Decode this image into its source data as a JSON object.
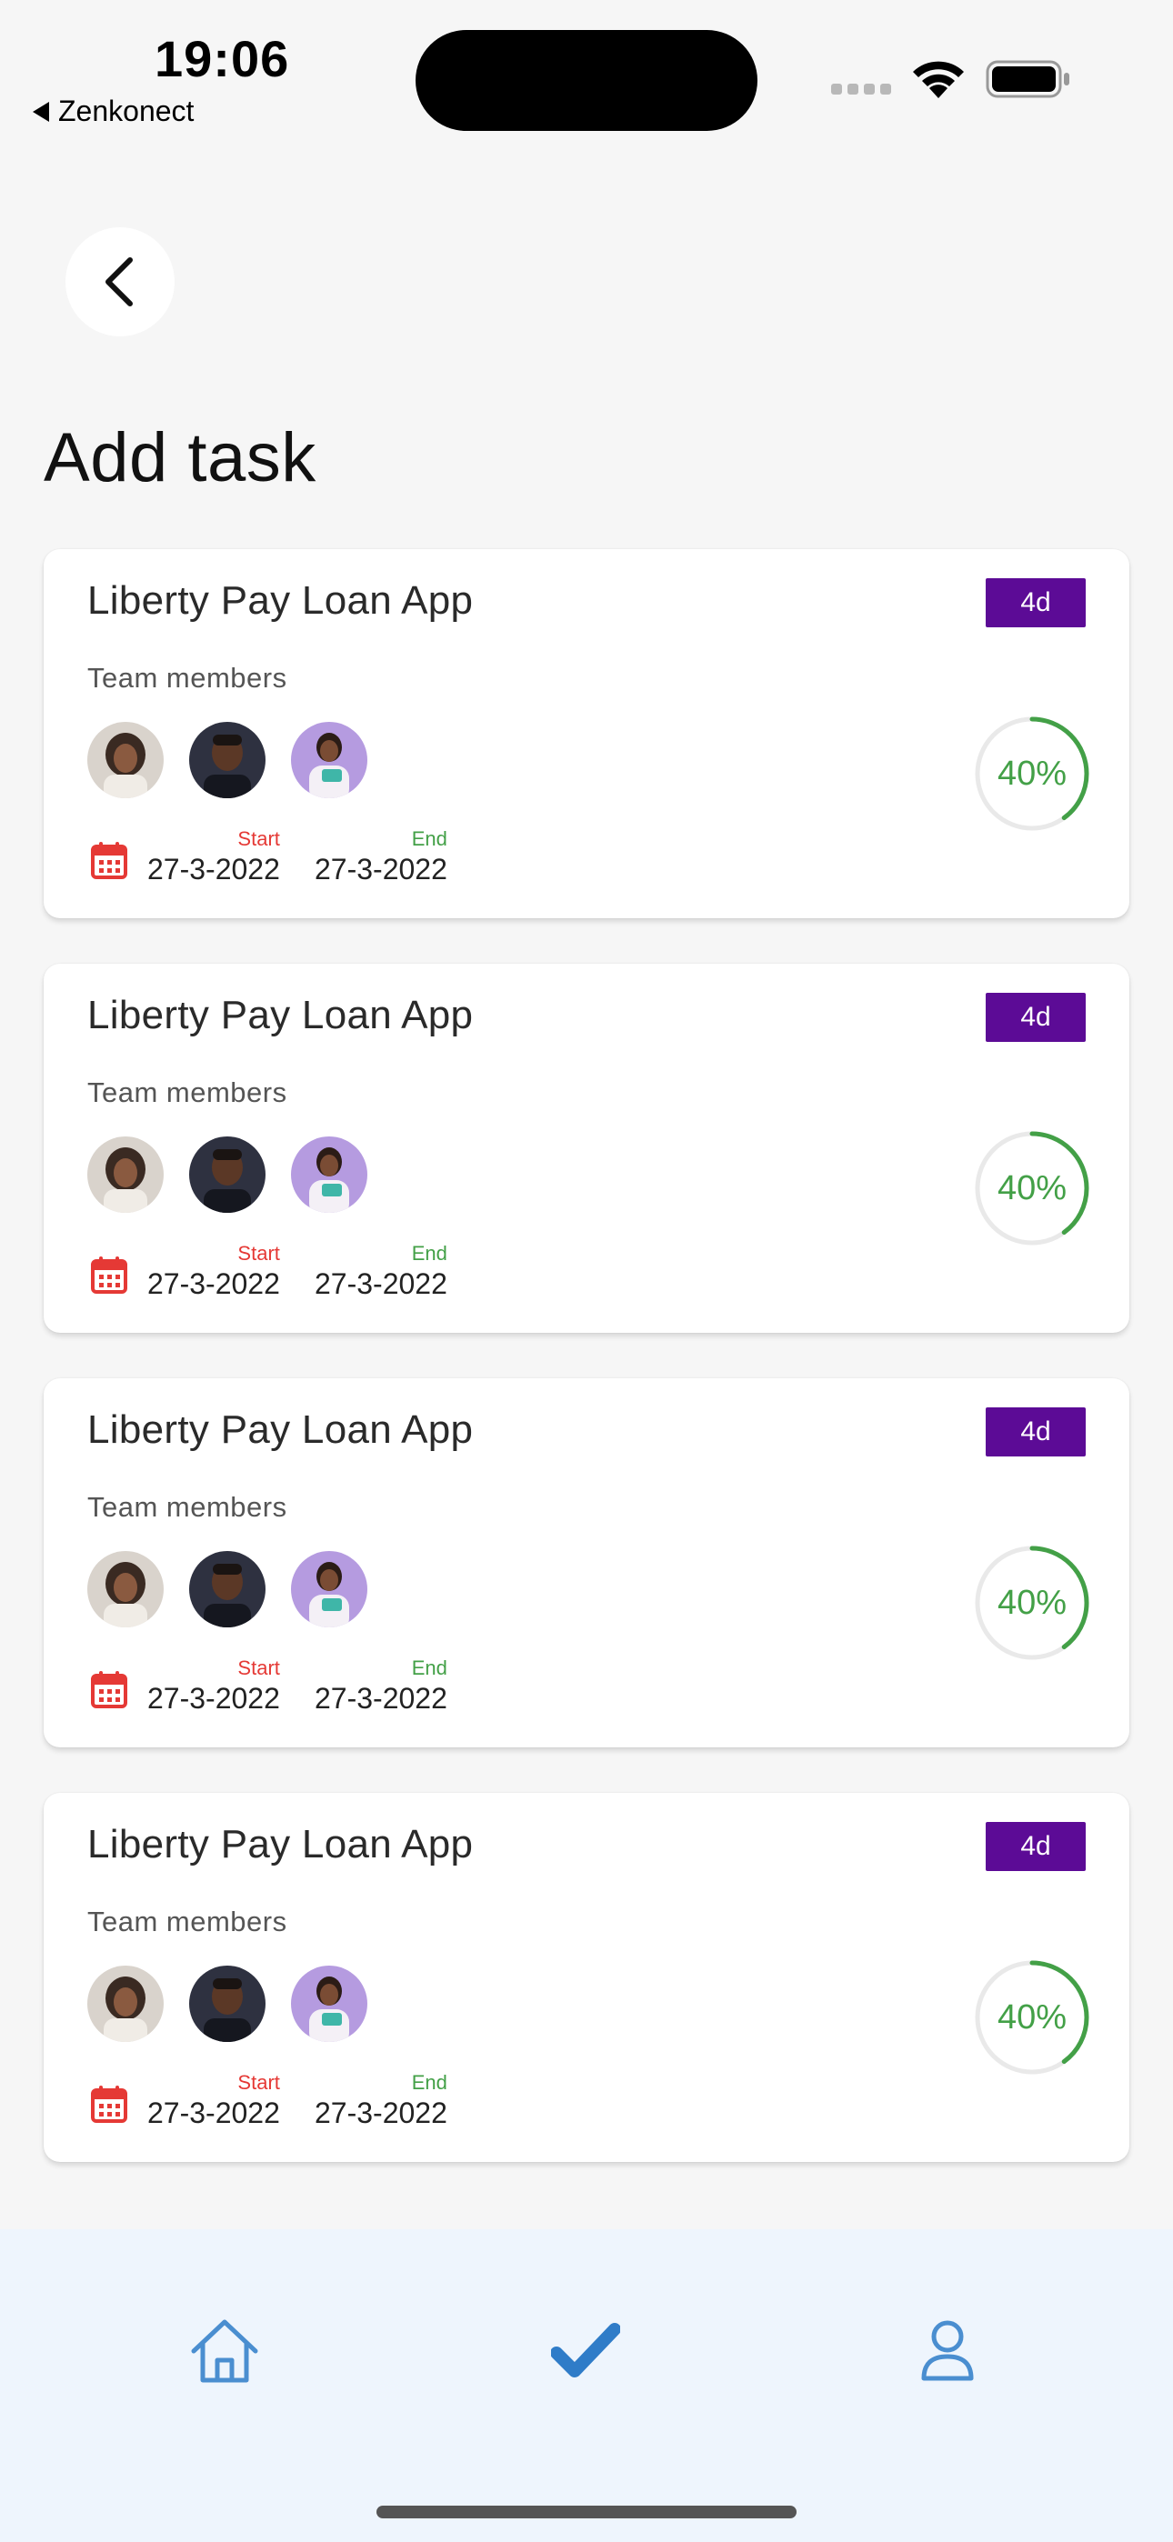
{
  "status_bar": {
    "time": "19:06",
    "back_app": "Zenkonect",
    "icons": [
      "signal-icon",
      "wifi-icon",
      "battery-icon"
    ]
  },
  "header": {
    "back_icon": "chevron-left-icon",
    "title": "Add task"
  },
  "colors": {
    "badge": "#5c0b96",
    "progress": "#43a047",
    "start": "#e53935",
    "end": "#43a047",
    "nav_accent": "#2f80c8"
  },
  "tasks": [
    {
      "title": "Liberty Pay Loan App",
      "duration": "4d",
      "team_label": "Team members",
      "start_label": "Start",
      "start_date": "27-3-2022",
      "end_label": "End",
      "end_date": "27-3-2022",
      "progress_label": "40%",
      "progress": 0.4
    },
    {
      "title": "Liberty Pay Loan App",
      "duration": "4d",
      "team_label": "Team members",
      "start_label": "Start",
      "start_date": "27-3-2022",
      "end_label": "End",
      "end_date": "27-3-2022",
      "progress_label": "40%",
      "progress": 0.4
    },
    {
      "title": "Liberty Pay Loan App",
      "duration": "4d",
      "team_label": "Team members",
      "start_label": "Start",
      "start_date": "27-3-2022",
      "end_label": "End",
      "end_date": "27-3-2022",
      "progress_label": "40%",
      "progress": 0.4
    },
    {
      "title": "Liberty Pay Loan App",
      "duration": "4d",
      "team_label": "Team members",
      "start_label": "Start",
      "start_date": "27-3-2022",
      "end_label": "End",
      "end_date": "27-3-2022",
      "progress_label": "40%",
      "progress": 0.4
    }
  ],
  "bottom_nav": {
    "items": [
      {
        "icon": "home-icon",
        "active": false
      },
      {
        "icon": "check-icon",
        "active": true
      },
      {
        "icon": "user-icon",
        "active": false
      }
    ]
  }
}
